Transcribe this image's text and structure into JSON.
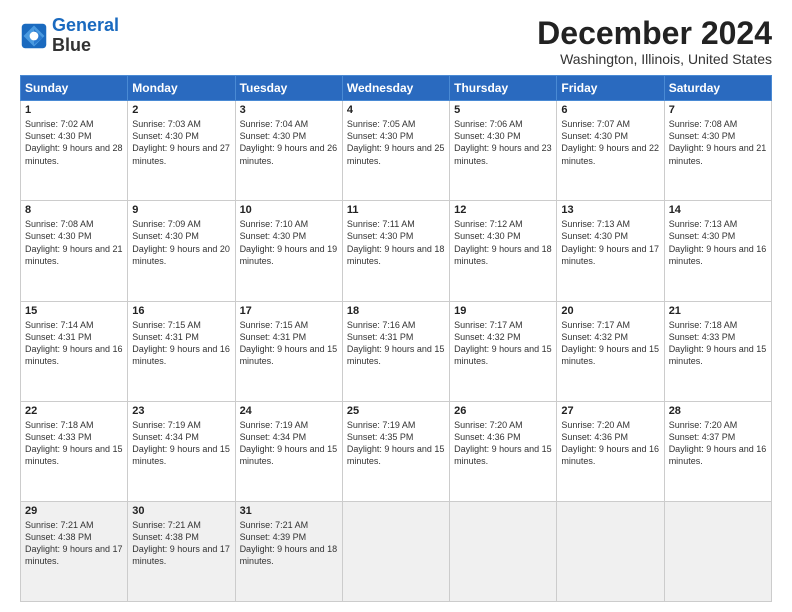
{
  "logo": {
    "line1": "General",
    "line2": "Blue"
  },
  "title": "December 2024",
  "location": "Washington, Illinois, United States",
  "days_header": [
    "Sunday",
    "Monday",
    "Tuesday",
    "Wednesday",
    "Thursday",
    "Friday",
    "Saturday"
  ],
  "weeks": [
    [
      {
        "day": "1",
        "sunrise": "7:02 AM",
        "sunset": "4:30 PM",
        "daylight": "9 hours and 28 minutes."
      },
      {
        "day": "2",
        "sunrise": "7:03 AM",
        "sunset": "4:30 PM",
        "daylight": "9 hours and 27 minutes."
      },
      {
        "day": "3",
        "sunrise": "7:04 AM",
        "sunset": "4:30 PM",
        "daylight": "9 hours and 26 minutes."
      },
      {
        "day": "4",
        "sunrise": "7:05 AM",
        "sunset": "4:30 PM",
        "daylight": "9 hours and 25 minutes."
      },
      {
        "day": "5",
        "sunrise": "7:06 AM",
        "sunset": "4:30 PM",
        "daylight": "9 hours and 23 minutes."
      },
      {
        "day": "6",
        "sunrise": "7:07 AM",
        "sunset": "4:30 PM",
        "daylight": "9 hours and 22 minutes."
      },
      {
        "day": "7",
        "sunrise": "7:08 AM",
        "sunset": "4:30 PM",
        "daylight": "9 hours and 21 minutes."
      }
    ],
    [
      {
        "day": "8",
        "sunrise": "7:08 AM",
        "sunset": "4:30 PM",
        "daylight": "9 hours and 21 minutes."
      },
      {
        "day": "9",
        "sunrise": "7:09 AM",
        "sunset": "4:30 PM",
        "daylight": "9 hours and 20 minutes."
      },
      {
        "day": "10",
        "sunrise": "7:10 AM",
        "sunset": "4:30 PM",
        "daylight": "9 hours and 19 minutes."
      },
      {
        "day": "11",
        "sunrise": "7:11 AM",
        "sunset": "4:30 PM",
        "daylight": "9 hours and 18 minutes."
      },
      {
        "day": "12",
        "sunrise": "7:12 AM",
        "sunset": "4:30 PM",
        "daylight": "9 hours and 18 minutes."
      },
      {
        "day": "13",
        "sunrise": "7:13 AM",
        "sunset": "4:30 PM",
        "daylight": "9 hours and 17 minutes."
      },
      {
        "day": "14",
        "sunrise": "7:13 AM",
        "sunset": "4:30 PM",
        "daylight": "9 hours and 16 minutes."
      }
    ],
    [
      {
        "day": "15",
        "sunrise": "7:14 AM",
        "sunset": "4:31 PM",
        "daylight": "9 hours and 16 minutes."
      },
      {
        "day": "16",
        "sunrise": "7:15 AM",
        "sunset": "4:31 PM",
        "daylight": "9 hours and 16 minutes."
      },
      {
        "day": "17",
        "sunrise": "7:15 AM",
        "sunset": "4:31 PM",
        "daylight": "9 hours and 15 minutes."
      },
      {
        "day": "18",
        "sunrise": "7:16 AM",
        "sunset": "4:31 PM",
        "daylight": "9 hours and 15 minutes."
      },
      {
        "day": "19",
        "sunrise": "7:17 AM",
        "sunset": "4:32 PM",
        "daylight": "9 hours and 15 minutes."
      },
      {
        "day": "20",
        "sunrise": "7:17 AM",
        "sunset": "4:32 PM",
        "daylight": "9 hours and 15 minutes."
      },
      {
        "day": "21",
        "sunrise": "7:18 AM",
        "sunset": "4:33 PM",
        "daylight": "9 hours and 15 minutes."
      }
    ],
    [
      {
        "day": "22",
        "sunrise": "7:18 AM",
        "sunset": "4:33 PM",
        "daylight": "9 hours and 15 minutes."
      },
      {
        "day": "23",
        "sunrise": "7:19 AM",
        "sunset": "4:34 PM",
        "daylight": "9 hours and 15 minutes."
      },
      {
        "day": "24",
        "sunrise": "7:19 AM",
        "sunset": "4:34 PM",
        "daylight": "9 hours and 15 minutes."
      },
      {
        "day": "25",
        "sunrise": "7:19 AM",
        "sunset": "4:35 PM",
        "daylight": "9 hours and 15 minutes."
      },
      {
        "day": "26",
        "sunrise": "7:20 AM",
        "sunset": "4:36 PM",
        "daylight": "9 hours and 15 minutes."
      },
      {
        "day": "27",
        "sunrise": "7:20 AM",
        "sunset": "4:36 PM",
        "daylight": "9 hours and 16 minutes."
      },
      {
        "day": "28",
        "sunrise": "7:20 AM",
        "sunset": "4:37 PM",
        "daylight": "9 hours and 16 minutes."
      }
    ],
    [
      {
        "day": "29",
        "sunrise": "7:21 AM",
        "sunset": "4:38 PM",
        "daylight": "9 hours and 17 minutes."
      },
      {
        "day": "30",
        "sunrise": "7:21 AM",
        "sunset": "4:38 PM",
        "daylight": "9 hours and 17 minutes."
      },
      {
        "day": "31",
        "sunrise": "7:21 AM",
        "sunset": "4:39 PM",
        "daylight": "9 hours and 18 minutes."
      },
      null,
      null,
      null,
      null
    ]
  ]
}
